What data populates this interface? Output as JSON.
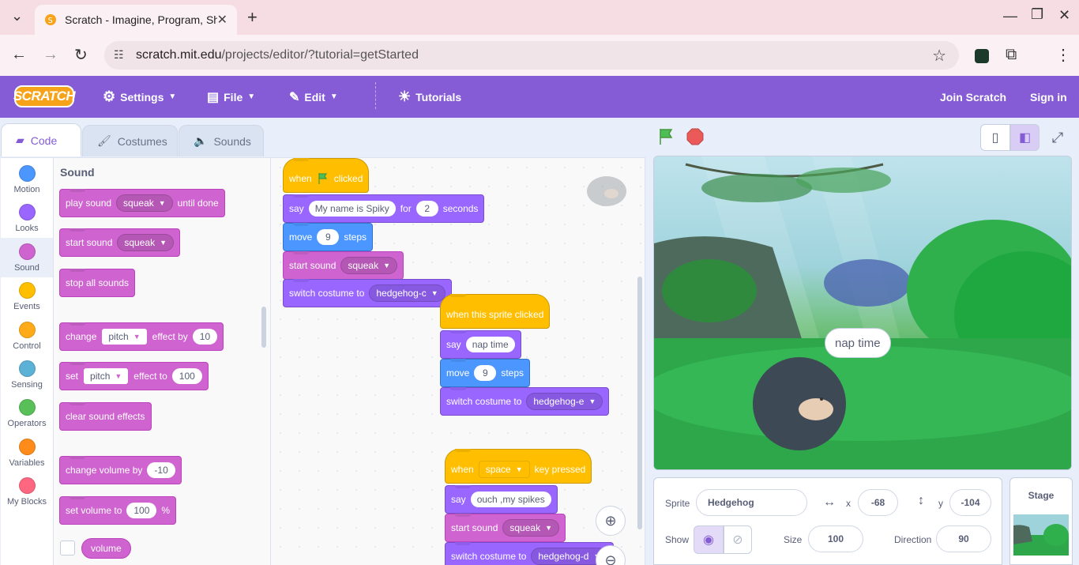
{
  "browser": {
    "tab_title": "Scratch - Imagine, Program, Sha",
    "url_host": "scratch.mit.edu",
    "url_path": "/projects/editor/?tutorial=getStarted"
  },
  "menubar": {
    "logo": "SCRATCH",
    "settings": "Settings",
    "file": "File",
    "edit": "Edit",
    "tutorials": "Tutorials",
    "join": "Join Scratch",
    "signin": "Sign in"
  },
  "editor_tabs": {
    "code": "Code",
    "costumes": "Costumes",
    "sounds": "Sounds"
  },
  "categories": [
    {
      "label": "Motion",
      "color": "#4c97ff"
    },
    {
      "label": "Looks",
      "color": "#9966ff"
    },
    {
      "label": "Sound",
      "color": "#cf63cf"
    },
    {
      "label": "Events",
      "color": "#ffbf00"
    },
    {
      "label": "Control",
      "color": "#ffab19"
    },
    {
      "label": "Sensing",
      "color": "#5cb1d6"
    },
    {
      "label": "Operators",
      "color": "#59c059"
    },
    {
      "label": "Variables",
      "color": "#ff8c1a"
    },
    {
      "label": "My Blocks",
      "color": "#ff6680"
    }
  ],
  "flyout": {
    "title": "Sound",
    "play_sound": "play sound",
    "until_done": "until done",
    "squeak": "squeak",
    "start_sound": "start sound",
    "stop_all": "stop all sounds",
    "change": "change",
    "pitch": "pitch",
    "effect_by": "effect by",
    "ten": "10",
    "set": "set",
    "effect_to": "effect to",
    "hundred": "100",
    "clear_effects": "clear sound effects",
    "change_volume": "change volume by",
    "minus_ten": "-10",
    "set_volume": "set volume to",
    "percent": "%",
    "volume": "volume"
  },
  "scripts": {
    "s1": {
      "when": "when",
      "clicked": "clicked",
      "say": "say",
      "say_text": "My name is Spiky",
      "for": "for",
      "secs": "2",
      "seconds": "seconds",
      "move": "move",
      "steps_n": "9",
      "steps": "steps",
      "start_sound": "start sound",
      "sound": "squeak",
      "switch_costume": "switch costume to",
      "costume": "hedgehog-c"
    },
    "s2": {
      "hat": "when this sprite clicked",
      "say": "say",
      "say_text": "nap time",
      "move": "move",
      "steps_n": "9",
      "steps": "steps",
      "switch_costume": "switch costume to",
      "costume": "hedgehog-e"
    },
    "s3": {
      "when": "when",
      "key": "space",
      "key_pressed": "key pressed",
      "say": "say",
      "say_text": "ouch ,my spikes",
      "start_sound": "start sound",
      "sound": "squeak",
      "switch_costume": "switch costume to",
      "costume": "hedgehog-d"
    }
  },
  "stage": {
    "speech": "nap time"
  },
  "sprite_info": {
    "sprite_label": "Sprite",
    "sprite_name": "Hedgehog",
    "x_label": "x",
    "x": "-68",
    "y_label": "y",
    "y": "-104",
    "show_label": "Show",
    "size_label": "Size",
    "size": "100",
    "direction_label": "Direction",
    "direction": "90"
  },
  "stage_pane": {
    "label": "Stage"
  }
}
